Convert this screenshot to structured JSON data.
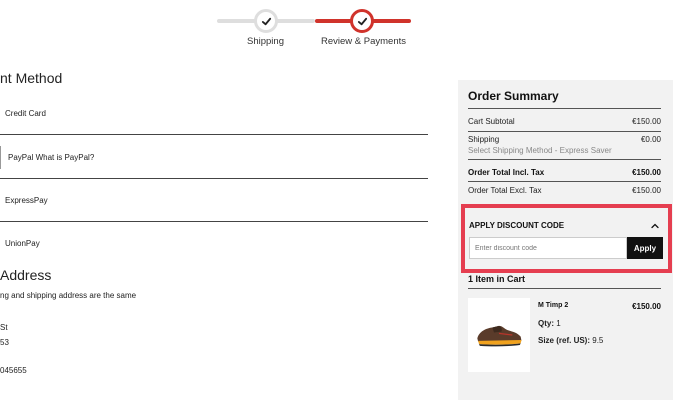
{
  "stepper": {
    "steps": [
      {
        "label": "Shipping"
      },
      {
        "label": "Review & Payments"
      }
    ]
  },
  "payment": {
    "title": "nt Method",
    "options": [
      {
        "label": "Credit Card"
      },
      {
        "label": "PayPal What is PayPal?"
      },
      {
        "label": "ExpressPay"
      },
      {
        "label": "UnionPay"
      }
    ]
  },
  "address": {
    "title": "Address",
    "same_note": "ng and shipping address are the same",
    "lines": [
      "St",
      "53",
      "045655"
    ]
  },
  "summary": {
    "title": "Order Summary",
    "cart_subtotal_label": "Cart Subtotal",
    "cart_subtotal_value": "€150.00",
    "shipping_label": "Shipping",
    "shipping_value": "€0.00",
    "shipping_method": "Select Shipping Method - Express Saver",
    "total_incl_label": "Order Total Incl. Tax",
    "total_incl_value": "€150.00",
    "total_excl_label": "Order Total Excl. Tax",
    "total_excl_value": "€150.00"
  },
  "discount": {
    "title": "APPLY DISCOUNT CODE",
    "placeholder": "Enter discount code",
    "apply_label": "Apply"
  },
  "cart": {
    "title": "1 Item in Cart",
    "item": {
      "name": "M Timp 2",
      "price": "€150.00",
      "qty_label": "Qty:",
      "qty_value": "1",
      "size_label": "Size (ref. US):",
      "size_value": "9.5"
    }
  },
  "colors": {
    "accent": "#d0332b",
    "highlight_border": "#e53e50",
    "panel_bg": "#f2f2f2"
  }
}
